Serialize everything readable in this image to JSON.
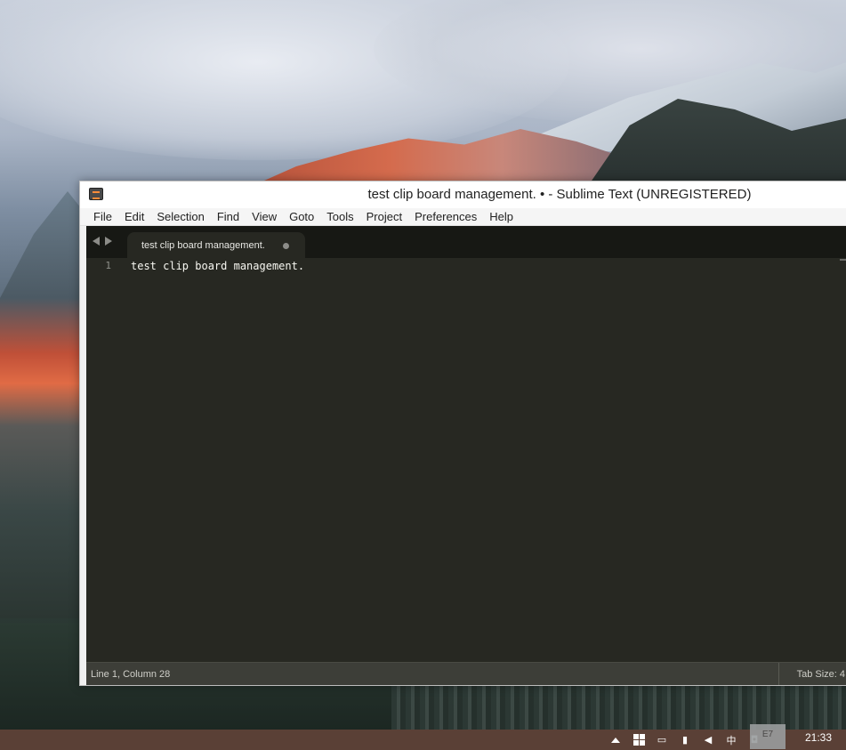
{
  "window": {
    "title": "test clip board management. • - Sublime Text (UNREGISTERED)"
  },
  "menu": {
    "items": [
      "File",
      "Edit",
      "Selection",
      "Find",
      "View",
      "Goto",
      "Tools",
      "Project",
      "Preferences",
      "Help"
    ]
  },
  "tabs": [
    {
      "label": "test clip board management.",
      "modified": true
    }
  ],
  "editor": {
    "lines": [
      {
        "number": "1",
        "text": "test clip board management."
      }
    ]
  },
  "statusbar": {
    "position": "Line 1, Column 28",
    "tab_size": "Tab Size: 4"
  },
  "taskbar": {
    "ime_char": "中",
    "popup_label": "E7",
    "clock": "21:33"
  },
  "colors": {
    "editor_bg": "#272822",
    "tabbar_bg": "#171814",
    "statusbar_bg": "#3d3e38",
    "taskbar_bg": "#5a4036"
  }
}
